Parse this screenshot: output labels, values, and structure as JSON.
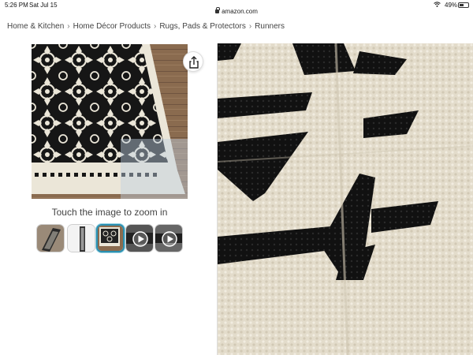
{
  "status_bar": {
    "time": "5:26 PM",
    "date": "Sat Jul 15",
    "address": "amazon.com",
    "battery_percent": "49%",
    "battery_level": 0.49,
    "wifi_icon": "wifi-icon",
    "lock_icon": "lock-icon",
    "battery_icon": "battery-icon"
  },
  "breadcrumb": {
    "items": [
      "Home & Kitchen",
      "Home Décor Products",
      "Rugs, Pads & Protectors",
      "Runners"
    ],
    "separator": "›"
  },
  "product_gallery": {
    "zoom_hint": "Touch the image to zoom in",
    "share_icon": "share-icon",
    "thumbnails": [
      {
        "name": "thumbnail-1",
        "kind": "image"
      },
      {
        "name": "thumbnail-2",
        "kind": "image"
      },
      {
        "name": "thumbnail-3",
        "kind": "image",
        "selected": true
      },
      {
        "name": "thumbnail-4",
        "kind": "video",
        "icon": "play-icon"
      },
      {
        "name": "thumbnail-5",
        "kind": "video",
        "icon": "play-icon"
      }
    ]
  },
  "colors": {
    "selected_border": "#2a8fb0",
    "rug_black": "#161616",
    "rug_cream": "#ebe6d8",
    "floor_wood": "#8a6b4f"
  }
}
